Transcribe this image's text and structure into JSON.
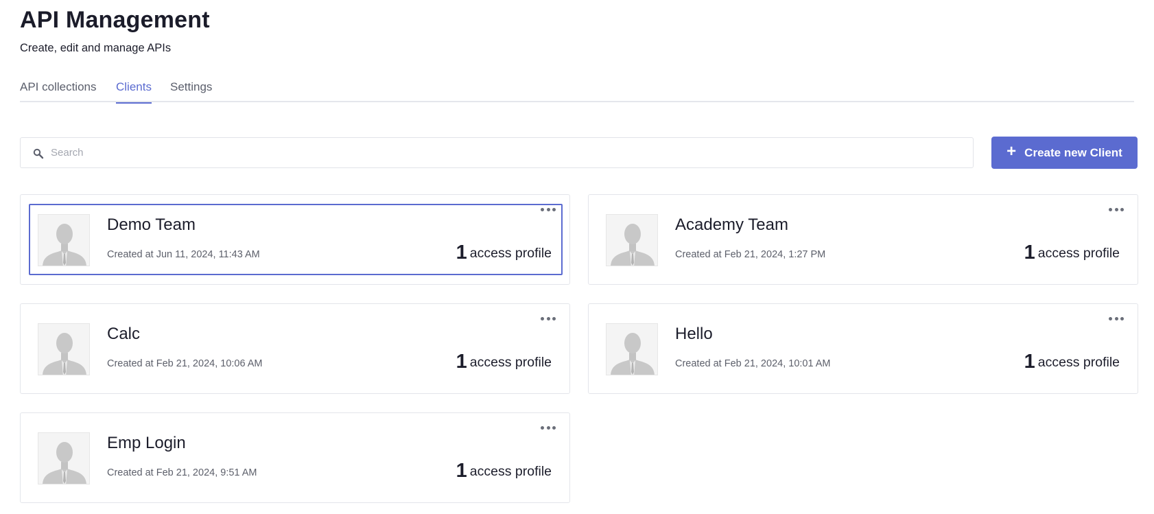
{
  "header": {
    "title": "API Management",
    "subtitle": "Create, edit and manage APIs"
  },
  "tabs": [
    {
      "label": "API collections",
      "active": false
    },
    {
      "label": "Clients",
      "active": true
    },
    {
      "label": "Settings",
      "active": false
    }
  ],
  "search": {
    "placeholder": "Search",
    "value": ""
  },
  "create_button": {
    "label": "Create new Client",
    "icon": "plus-icon"
  },
  "clients": [
    {
      "name": "Demo Team",
      "created": "Created at Jun 11, 2024, 11:43 AM",
      "count": "1",
      "count_label": "access profile",
      "selected": true
    },
    {
      "name": "Academy Team",
      "created": "Created at Feb 21, 2024, 1:27 PM",
      "count": "1",
      "count_label": "access profile",
      "selected": false
    },
    {
      "name": "Calc",
      "created": "Created at Feb 21, 2024, 10:06 AM",
      "count": "1",
      "count_label": "access profile",
      "selected": false
    },
    {
      "name": "Hello",
      "created": "Created at Feb 21, 2024, 10:01 AM",
      "count": "1",
      "count_label": "access profile",
      "selected": false
    },
    {
      "name": "Emp Login",
      "created": "Created at Feb 21, 2024, 9:51 AM",
      "count": "1",
      "count_label": "access profile",
      "selected": false
    }
  ],
  "colors": {
    "accent": "#5b6bd0",
    "border": "#e3e5ea",
    "text": "#1c1d2b",
    "muted": "#5c5f6a"
  }
}
